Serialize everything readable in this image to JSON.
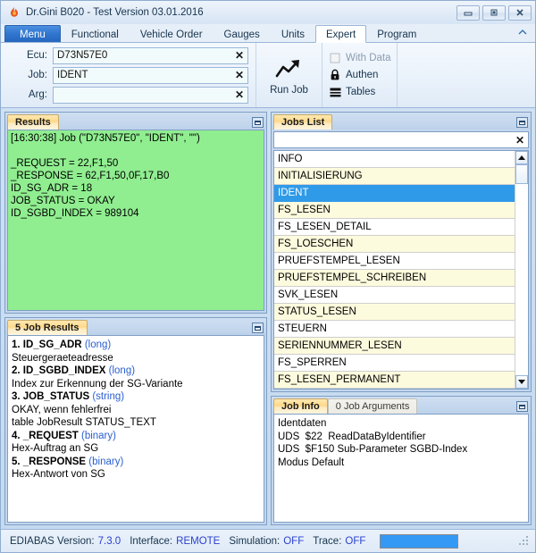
{
  "window": {
    "title": "Dr.Gini B020 - Test Version 03.01.2016",
    "app_icon": "flame-icon",
    "minimize_label": "Minimize",
    "maximize_label": "Maximize",
    "close_label": "Close"
  },
  "ribbon": {
    "tabs": [
      {
        "label": "Menu",
        "name": "tab-menu",
        "state": "menu"
      },
      {
        "label": "Functional",
        "name": "tab-functional",
        "state": "normal"
      },
      {
        "label": "Vehicle Order",
        "name": "tab-vehicle-order",
        "state": "normal"
      },
      {
        "label": "Gauges",
        "name": "tab-gauges",
        "state": "normal"
      },
      {
        "label": "Units",
        "name": "tab-units",
        "state": "normal"
      },
      {
        "label": "Expert",
        "name": "tab-expert",
        "state": "active"
      },
      {
        "label": "Program",
        "name": "tab-program",
        "state": "normal"
      }
    ],
    "collapse_icon": "chevron-up-icon",
    "fields": [
      {
        "label": "Ecu:",
        "value": "D73N57E0",
        "placeholder": "",
        "clear": "✕"
      },
      {
        "label": "Job:",
        "value": "IDENT",
        "placeholder": "",
        "clear": "✕"
      },
      {
        "label": "Arg:",
        "value": "",
        "placeholder": "",
        "clear": "✕"
      }
    ],
    "run_job": {
      "label": "Run Job",
      "icon": "trend-arrow-icon"
    },
    "options": [
      {
        "label": "With Data",
        "icon": "checkbox-unchecked-icon",
        "disabled": true
      },
      {
        "label": "Authen",
        "icon": "lock-icon",
        "disabled": false
      },
      {
        "label": "Tables",
        "icon": "tables-icon",
        "disabled": false
      }
    ]
  },
  "results_panel": {
    "tab_label": "Results",
    "maximize_icon": "maximize-icon",
    "background_color": "#90ee90",
    "text": "[16:30:38] Job (\"D73N57E0\", \"IDENT\", \"\")\n\n_REQUEST = 22,F1,50\n_RESPONSE = 62,F1,50,0F,17,B0\nID_SG_ADR = 18\nJOB_STATUS = OKAY\nID_SGBD_INDEX = 989104"
  },
  "job_results_panel": {
    "tab_label": "5 Job Results",
    "maximize_icon": "maximize-icon",
    "items": [
      {
        "index": "1.",
        "name": "ID_SG_ADR",
        "type": "(long)",
        "desc": [
          "Steuergeraeteadresse"
        ]
      },
      {
        "index": "2.",
        "name": "ID_SGBD_INDEX",
        "type": "(long)",
        "desc": [
          "Index zur Erkennung der SG-Variante"
        ]
      },
      {
        "index": "3.",
        "name": "JOB_STATUS",
        "type": "(string)",
        "desc": [
          "OKAY, wenn fehlerfrei",
          "table JobResult STATUS_TEXT"
        ]
      },
      {
        "index": "4.",
        "name": "_REQUEST",
        "type": "(binary)",
        "desc": [
          "Hex-Auftrag an SG"
        ]
      },
      {
        "index": "5.",
        "name": "_RESPONSE",
        "type": "(binary)",
        "desc": [
          "Hex-Antwort von SG"
        ]
      }
    ]
  },
  "jobs_list_panel": {
    "tab_label": "Jobs List",
    "maximize_icon": "maximize-icon",
    "search": {
      "value": "",
      "placeholder": "",
      "clear": "✕"
    },
    "selected": "IDENT",
    "items": [
      "INFO",
      "INITIALISIERUNG",
      "IDENT",
      "FS_LESEN",
      "FS_LESEN_DETAIL",
      "FS_LOESCHEN",
      "PRUEFSTEMPEL_LESEN",
      "PRUEFSTEMPEL_SCHREIBEN",
      "SVK_LESEN",
      "STATUS_LESEN",
      "STEUERN",
      "SERIENNUMMER_LESEN",
      "FS_SPERREN",
      "FS_LESEN_PERMANENT"
    ],
    "scrollbar": {
      "up_icon": "arrow-up-icon",
      "down_icon": "arrow-down-icon"
    }
  },
  "job_info_panel": {
    "tabs": [
      {
        "label": "Job Info",
        "active": true
      },
      {
        "label": "0 Job Arguments",
        "active": false
      }
    ],
    "maximize_icon": "maximize-icon",
    "text": "Identdaten\nUDS  $22  ReadDataByIdentifier\nUDS  $F150 Sub-Parameter SGBD-Index\nModus Default"
  },
  "status_bar": {
    "fields": [
      {
        "label": "EDIABAS Version:",
        "value": "7.3.0"
      },
      {
        "label": "Interface:",
        "value": "REMOTE"
      },
      {
        "label": "Simulation:",
        "value": "OFF"
      },
      {
        "label": "Trace:",
        "value": "OFF"
      }
    ],
    "progress_percent": 100,
    "progress_color": "#3399f5",
    "grip_icon": "resize-grip-icon"
  }
}
